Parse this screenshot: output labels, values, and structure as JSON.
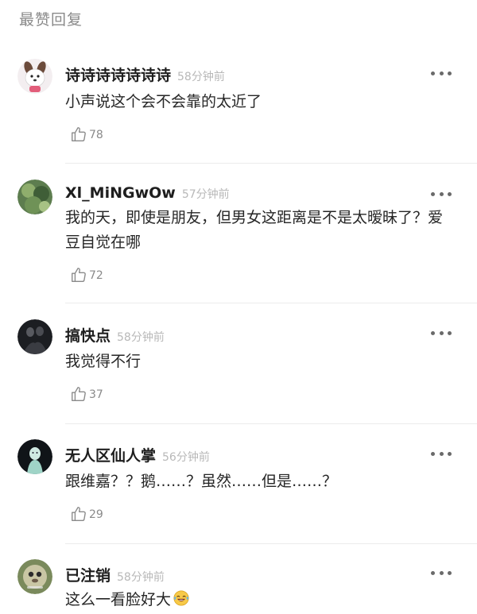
{
  "section_title": "最赞回复",
  "comments": [
    {
      "username": "诗诗诗诗诗诗诗",
      "time": "58分钟前",
      "text": "小声说这个会不会靠的太近了",
      "likes": "78",
      "avatar": "cartoon-dog-avatar"
    },
    {
      "username": "Xl_MiNGwOw",
      "time": "57分钟前",
      "text": "我的天，即使是朋友，但男女这距离是不是太暧昧了？爱豆自觉在哪",
      "likes": "72",
      "avatar": "green-nature-avatar"
    },
    {
      "username": "搞快点",
      "time": "58分钟前",
      "text": "我觉得不行",
      "likes": "37",
      "avatar": "dark-photo-avatar"
    },
    {
      "username": "无人区仙人掌",
      "time": "56分钟前",
      "text": "跟维嘉？？鹅……？虽然……但是……？",
      "likes": "29",
      "avatar": "ghost-figure-avatar"
    },
    {
      "username": "已注销",
      "time": "58分钟前",
      "text": "这么一看脸好大",
      "emoji": "laughing-tears-emoji",
      "avatar": "deleted-user-avatar"
    }
  ],
  "colors": {
    "username": "#1e1e1e",
    "time": "#b8b8b8",
    "text": "#262626",
    "meta": "#8a8a8a",
    "divider": "#ececec"
  }
}
